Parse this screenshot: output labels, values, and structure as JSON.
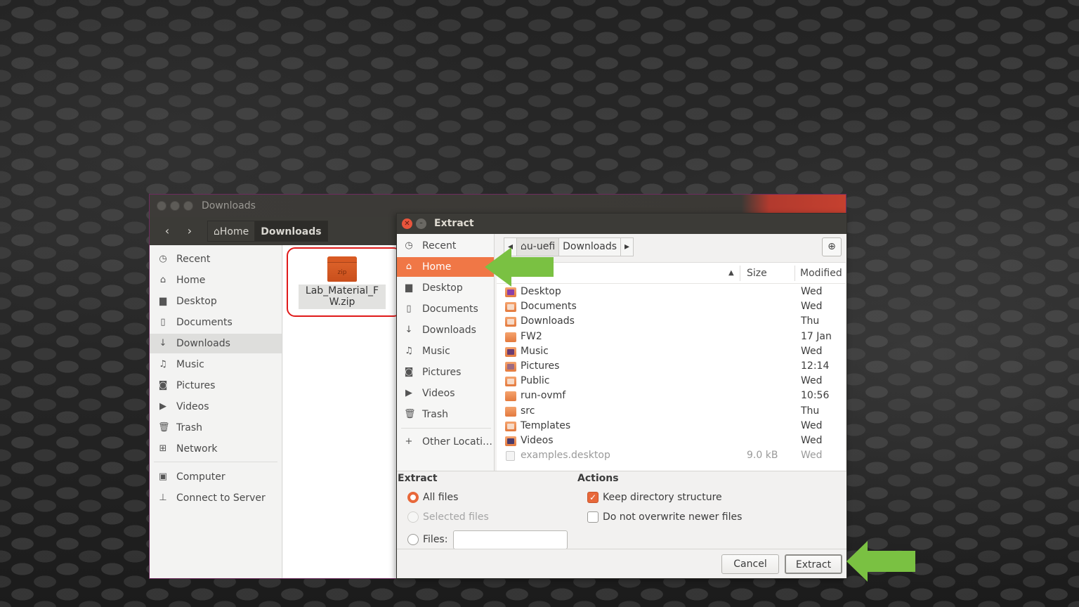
{
  "file_manager": {
    "title": "Downloads",
    "path": [
      "Home",
      "Downloads"
    ],
    "sidebar": [
      {
        "label": "Recent",
        "icon": "clock-icon"
      },
      {
        "label": "Home",
        "icon": "home-icon"
      },
      {
        "label": "Desktop",
        "icon": "folder-icon"
      },
      {
        "label": "Documents",
        "icon": "document-icon"
      },
      {
        "label": "Downloads",
        "icon": "download-icon",
        "selected": true
      },
      {
        "label": "Music",
        "icon": "music-icon"
      },
      {
        "label": "Pictures",
        "icon": "camera-icon"
      },
      {
        "label": "Videos",
        "icon": "video-icon"
      },
      {
        "label": "Trash",
        "icon": "trash-icon"
      },
      {
        "label": "Network",
        "icon": "network-icon"
      },
      {
        "label": "Computer",
        "icon": "computer-icon"
      },
      {
        "label": "Connect to Server",
        "icon": "server-icon"
      }
    ],
    "file": {
      "name": "Lab_Material_FW.zip",
      "icon_text": "zip"
    }
  },
  "extract_dialog": {
    "title": "Extract",
    "sidebar": [
      {
        "label": "Recent",
        "icon": "clock-icon"
      },
      {
        "label": "Home",
        "icon": "home-icon",
        "selected": true
      },
      {
        "label": "Desktop",
        "icon": "folder-icon"
      },
      {
        "label": "Documents",
        "icon": "document-icon"
      },
      {
        "label": "Downloads",
        "icon": "download-icon"
      },
      {
        "label": "Music",
        "icon": "music-icon"
      },
      {
        "label": "Pictures",
        "icon": "camera-icon"
      },
      {
        "label": "Videos",
        "icon": "video-icon"
      },
      {
        "label": "Trash",
        "icon": "trash-icon"
      },
      {
        "label": "Other Locati…",
        "icon": "plus-icon"
      }
    ],
    "path": [
      "u-uefi",
      "Downloads"
    ],
    "columns": {
      "size": "Size",
      "modified": "Modified"
    },
    "files": [
      {
        "name": "Desktop",
        "size": "",
        "modified": "Wed",
        "kind": "desk"
      },
      {
        "name": "Documents",
        "size": "",
        "modified": "Wed",
        "kind": "folder"
      },
      {
        "name": "Downloads",
        "size": "",
        "modified": "Thu",
        "kind": "folder"
      },
      {
        "name": "FW2",
        "size": "",
        "modified": "17 Jan",
        "kind": "plain"
      },
      {
        "name": "Music",
        "size": "",
        "modified": "Wed",
        "kind": "music"
      },
      {
        "name": "Pictures",
        "size": "",
        "modified": "12:14",
        "kind": "pics"
      },
      {
        "name": "Public",
        "size": "",
        "modified": "Wed",
        "kind": "folder"
      },
      {
        "name": "run-ovmf",
        "size": "",
        "modified": "10:56",
        "kind": "plain"
      },
      {
        "name": "src",
        "size": "",
        "modified": "Thu",
        "kind": "plain"
      },
      {
        "name": "Templates",
        "size": "",
        "modified": "Wed",
        "kind": "folder"
      },
      {
        "name": "Videos",
        "size": "",
        "modified": "Wed",
        "kind": "vids"
      },
      {
        "name": "examples.desktop",
        "size": "9.0 kB",
        "modified": "Wed",
        "kind": "doc",
        "dim": true
      }
    ],
    "extract_group": {
      "title": "Extract",
      "all_files": "All files",
      "selected_files": "Selected files",
      "files_label": "Files:",
      "files_value": ""
    },
    "actions_group": {
      "title": "Actions",
      "keep_structure": "Keep directory structure",
      "keep_structure_checked": true,
      "no_overwrite": "Do not overwrite newer files",
      "no_overwrite_checked": false
    },
    "buttons": {
      "cancel": "Cancel",
      "extract": "Extract"
    }
  },
  "colors": {
    "accent": "#f07746",
    "annotation_arrow": "#7ac142",
    "annotation_box": "#e01a1a"
  }
}
